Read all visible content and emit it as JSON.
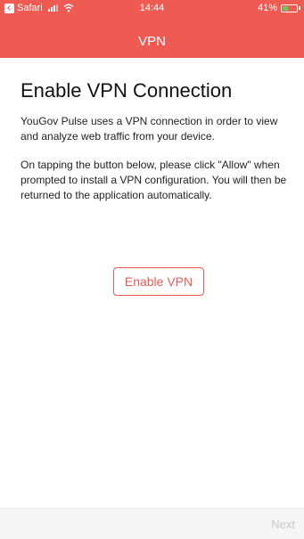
{
  "status_bar": {
    "back_app": "Safari",
    "time": "14:44",
    "battery_percent": "41%",
    "battery_level": 0.41
  },
  "nav": {
    "title": "VPN"
  },
  "main": {
    "heading": "Enable VPN Connection",
    "paragraph_1": "YouGov Pulse uses a VPN connection in order to view and analyze web traffic from your device.",
    "paragraph_2": "On tapping the button below, please click \"Allow\" when prompted to install a VPN configuration. You will then be returned to the application automatically.",
    "enable_button_label": "Enable VPN"
  },
  "footer": {
    "next_label": "Next"
  },
  "colors": {
    "accent": "#ef5a52",
    "battery": "#5ccf5c",
    "disabled_text": "#c9c9c9"
  },
  "icons": [
    "back-to-app-icon",
    "cellular-signal-icon",
    "wifi-icon",
    "battery-icon"
  ]
}
